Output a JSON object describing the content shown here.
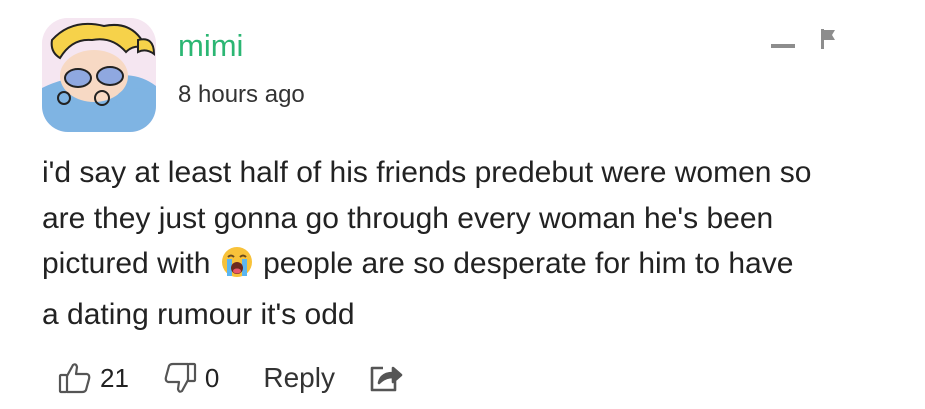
{
  "comment": {
    "username": "mimi",
    "timestamp": "8 hours ago",
    "body_before_emoji": "i'd say at least half of his friends predebut were women so\nare they just gonna go through every woman he's been\npictured with ",
    "body_after_emoji": " people are so desperate for him to have\na dating rumour it's odd",
    "emoji": "loudly-crying-face",
    "likes": "21",
    "dislikes": "0",
    "reply_label": "Reply"
  },
  "colors": {
    "username": "#2bb673",
    "icon_gray": "#8d8d8d",
    "text": "#222222"
  },
  "icons": [
    "collapse-icon",
    "flag-icon",
    "thumbs-up-icon",
    "thumbs-down-icon",
    "share-icon"
  ]
}
